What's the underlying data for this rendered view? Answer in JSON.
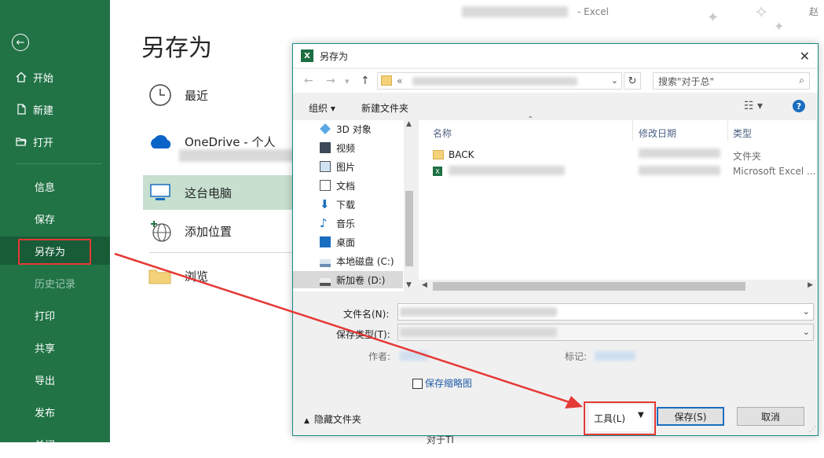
{
  "window": {
    "title_suffix": "-  Excel",
    "user_initial": "赵"
  },
  "nav": {
    "items": [
      {
        "label": "开始"
      },
      {
        "label": "新建"
      },
      {
        "label": "打开"
      },
      {
        "label": "信息"
      },
      {
        "label": "保存"
      },
      {
        "label": "另存为"
      },
      {
        "label": "历史记录"
      },
      {
        "label": "打印"
      },
      {
        "label": "共享"
      },
      {
        "label": "导出"
      },
      {
        "label": "发布"
      },
      {
        "label": "关闭"
      }
    ]
  },
  "backstage": {
    "title": "另存为",
    "locations": [
      {
        "label": "最近"
      },
      {
        "label": "OneDrive - 个人"
      },
      {
        "label": "这台电脑"
      },
      {
        "label": "添加位置"
      },
      {
        "label": "浏览"
      }
    ]
  },
  "dialog": {
    "title": "另存为",
    "address_prefix": "«",
    "search_placeholder": "搜索\"对于总\"",
    "toolbar": {
      "organize": "组织 ▾",
      "new_folder": "新建文件夹"
    },
    "tree": [
      {
        "label": "3D 对象"
      },
      {
        "label": "视频"
      },
      {
        "label": "图片"
      },
      {
        "label": "文档"
      },
      {
        "label": "下载"
      },
      {
        "label": "音乐"
      },
      {
        "label": "桌面"
      },
      {
        "label": "本地磁盘 (C:)"
      },
      {
        "label": "新加卷 (D:)"
      }
    ],
    "columns": {
      "name": "名称",
      "date": "修改日期",
      "type": "类型"
    },
    "files": [
      {
        "name": "BACK",
        "type": "文件夹"
      },
      {
        "name": "",
        "type": "Microsoft Excel ..."
      }
    ],
    "form": {
      "filename_label": "文件名(N):",
      "filetype_label": "保存类型(T):",
      "authors_label": "作者:",
      "tags_label": "标记:",
      "thumbnail_label": "保存缩略图"
    },
    "footer": {
      "hide_folders": "隐藏文件夹",
      "tools": "工具(L)",
      "save": "保存(S)",
      "cancel": "取消"
    }
  },
  "bottom_snippet": "对于TI",
  "colors": {
    "nav_green": "#217346",
    "selected_green": "#c6dfcf",
    "highlight_red": "#e53935",
    "accent_blue": "#1a6ebf"
  }
}
